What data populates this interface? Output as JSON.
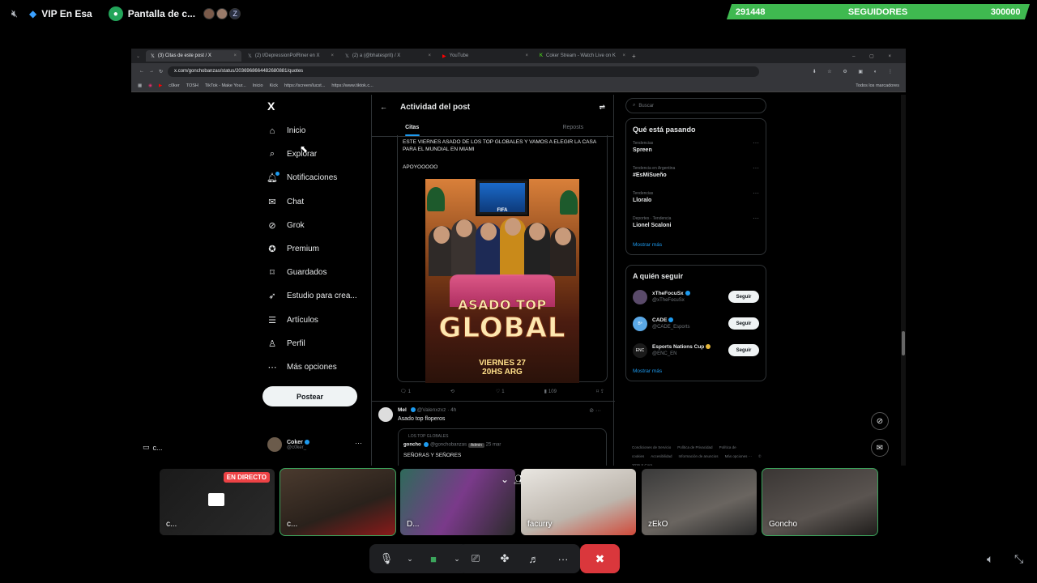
{
  "discord": {
    "voice_channel": "VIP En Esa",
    "screen_share_label": "Pantalla de c...",
    "followers": {
      "current": "291448",
      "label": "SEGUIDORES",
      "goal": "300000"
    },
    "accent_green": "#3fb950"
  },
  "browser": {
    "tabs": [
      "(3) Citas de este post / X",
      "(2) t/DepressionPolRiner en X",
      "(2) a (@bhatesprit) / X",
      "YouTube",
      "Coker Stream - Watch Live on K"
    ],
    "url": "x.com/gonchobanzas/status/2036968664482680881/quotes",
    "bookmarks": [
      "c0ker",
      "TOSH",
      "TikTok - Make Your...",
      "Inicio",
      "Kick",
      "https://screen/lucst...",
      "https://www.tiktok.c..."
    ],
    "bookmarks_folder": "Todos los marcadores"
  },
  "x": {
    "logo": "X",
    "nav": [
      {
        "label": "Inicio",
        "icon": "home-icon",
        "glyph": "⌂"
      },
      {
        "label": "Explorar",
        "icon": "search-icon",
        "glyph": "⌕"
      },
      {
        "label": "Notificaciones",
        "icon": "bell-icon",
        "glyph": "🔔︎"
      },
      {
        "label": "Chat",
        "icon": "mail-icon",
        "glyph": "✉"
      },
      {
        "label": "Grok",
        "icon": "grok-icon",
        "glyph": "⊘"
      },
      {
        "label": "Premium",
        "icon": "premium-icon",
        "glyph": "✪"
      },
      {
        "label": "Guardados",
        "icon": "bookmark-icon",
        "glyph": "⌑"
      },
      {
        "label": "Estudio para crea...",
        "icon": "rocket-icon",
        "glyph": "➶"
      },
      {
        "label": "Artículos",
        "icon": "article-icon",
        "glyph": "☰"
      },
      {
        "label": "Perfil",
        "icon": "profile-icon",
        "glyph": "♙"
      },
      {
        "label": "Más opciones",
        "icon": "more-circle-icon",
        "glyph": "⋯"
      }
    ],
    "post_button": "Postear",
    "account": {
      "name": "Coker",
      "handle": "@c0ker_"
    },
    "center": {
      "title": "Actividad del post",
      "tabs": [
        "Citas",
        "",
        "Reposts"
      ],
      "quote_text": "ESTE VIERNES ASADO DE LOS TOP GLOBALES Y VAMOS A ELEGIR LA CASA PARA EL MUNDIAL EN MIAMI",
      "quote_text2": "APOYOOOOO",
      "poster": {
        "title1": "ASADO TOP",
        "title2": "GLOBAL",
        "date": "VIERNES 27",
        "time": "20HS ARG",
        "tv_label": "FIFA"
      },
      "actions": {
        "replies": "1",
        "reposts": "",
        "likes": "1",
        "views": "109"
      },
      "reply": {
        "name": "Mel",
        "handle": "@Valenxzxz · 4h",
        "text": "Asado top floperos",
        "context": "LOS TOP GLOBALES",
        "inner_name": "goncho",
        "inner_handle": "@gonchobanzas",
        "inner_badge": "Admin",
        "inner_date": "25 mar",
        "inner_text": "SEÑORAS Y SEÑORES"
      }
    },
    "search_placeholder": "Buscar",
    "trends_title": "Qué está pasando",
    "trends": [
      {
        "context": "Tendencias",
        "name": "Spreen"
      },
      {
        "context": "Tendencia en Argentina",
        "name": "#EsMiSueño"
      },
      {
        "context": "Tendencias",
        "name": "Lloralo"
      },
      {
        "context": "Deportes · Tendencia",
        "name": "Lionel Scaloni"
      }
    ],
    "show_more": "Mostrar más",
    "who_title": "A quién seguir",
    "who": [
      {
        "name": "xTheFocuSx",
        "handle": "@xTheFocuSx",
        "avatar": ""
      },
      {
        "name": "CADE",
        "handle": "@CADE_Esports",
        "avatar": "Bª"
      },
      {
        "name": "Esports Nations Cup",
        "handle": "@ENC_EN",
        "avatar": "ENC"
      }
    ],
    "follow_label": "Seguir",
    "footer": [
      "Condiciones de Servicio",
      "Política de Privacidad",
      "Política de cookies",
      "Accesibilidad",
      "Información de anuncios",
      "Más opciones ···",
      "© 2026 X Corp."
    ]
  },
  "tiles": [
    {
      "name": "c...",
      "live": "EN DIRECTO"
    },
    {
      "name": "c..."
    },
    {
      "name": "D..."
    },
    {
      "name": "facurry"
    },
    {
      "name": "zEkO"
    },
    {
      "name": "Goncho"
    }
  ],
  "mini_chat": "c..."
}
